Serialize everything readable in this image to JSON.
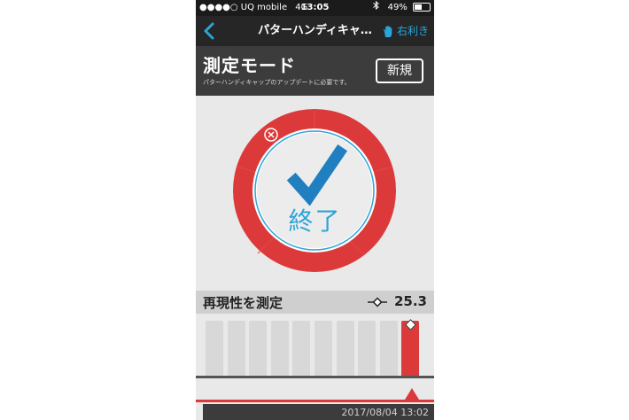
{
  "status_bar": {
    "carrier": "●●●●○ UQ mobile",
    "network": "4G",
    "time": "13:05",
    "battery": "49%",
    "battery_level": 0.49
  },
  "nav": {
    "title": "パターハンディキャ…",
    "hand_label": "右利き",
    "back_icon": "chevron-left-icon",
    "hand_icon": "hand-icon"
  },
  "mode": {
    "title": "測定モード",
    "subtitle": "パターハンディキャップのアップデートに必要です。",
    "new_button": "新規"
  },
  "dial": {
    "status_label": "終了",
    "check_icon": "checkmark-icon",
    "cancel_icon": "close-circle-icon"
  },
  "measurement": {
    "title": "再現性を測定",
    "value": "25.3",
    "value_icon": "diamond-line-icon"
  },
  "history": {
    "bar_count": 10,
    "active_index": 9,
    "date": "2017/08/04 13:02"
  },
  "colors": {
    "accent_blue": "#2aa5d9",
    "accent_red": "#dc3a3a",
    "dark_bg": "#262626",
    "panel_bg": "#3c3c3c"
  }
}
